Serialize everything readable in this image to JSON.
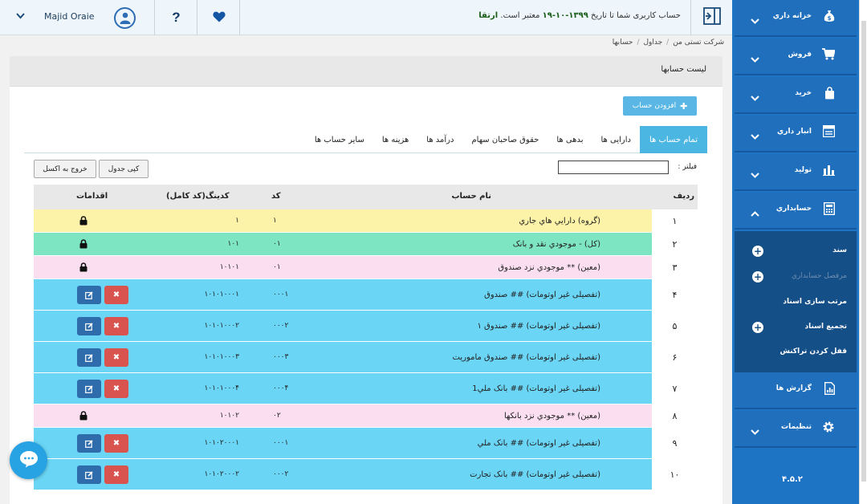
{
  "header": {
    "user_name": "Majid Oraie",
    "help_label": "?",
    "account_msg_prefix": "حساب کاربری شما تا تاریخ",
    "account_msg_date": "۱۳۹۹-۱۰-۱۹",
    "account_msg_suffix": "معتبر است.",
    "upgrade_label": "ارتقا"
  },
  "breadcrumb": [
    "شرکت تستی من",
    "جداول",
    "حسابها"
  ],
  "panel": {
    "title": "لیست حسابها",
    "add_button": "افزودن حساب",
    "filter_label": "فیلتر :",
    "filter_value": "",
    "copy_button": "کپی جدول",
    "excel_button": "خروج به اکسل"
  },
  "tabs": [
    "تمام حساب ها",
    "دارایی ها",
    "بدهی ها",
    "حقوق صاحبان سهام",
    "درآمد ها",
    "هزینه ها",
    "سایر حساب ها"
  ],
  "table": {
    "headers": {
      "row": "ردیف",
      "name": "نام حساب",
      "code": "کد",
      "full_code": "کدینگ(کد کامل)",
      "actions": "اقدامات"
    },
    "rows": [
      {
        "n": "۱",
        "name": "(گروه) دارايي هاي جاري",
        "code": "۱",
        "full": "۱",
        "type": "group",
        "color": "#fdf3a8"
      },
      {
        "n": "۲",
        "name": "(کل) - موجودي نقد و بانک",
        "code": "۰۱",
        "full": "۱۰۱",
        "type": "general",
        "color": "#7ee5c3"
      },
      {
        "n": "۳",
        "name": "(معین) ** موجودي نزد صندوق",
        "code": "۰۱",
        "full": "۱۰۱۰۱",
        "type": "subsidiary",
        "color": "#fbdff1"
      },
      {
        "n": "۴",
        "name": "(تفصیلی غیر اوتومات) ## صندوق",
        "code": "۰۰۰۱",
        "full": "۱۰۱۰۱۰۰۰۱",
        "type": "detail",
        "color": "#6ad5f5"
      },
      {
        "n": "۵",
        "name": "(تفصیلی غیر اوتومات) ## صندوق ۱",
        "code": "۰۰۰۲",
        "full": "۱۰۱۰۱۰۰۰۲",
        "type": "detail",
        "color": "#6ad5f5"
      },
      {
        "n": "۶",
        "name": "(تفصیلی غیر اوتومات) ## صندوق ماموريت",
        "code": "۰۰۰۳",
        "full": "۱۰۱۰۱۰۰۰۳",
        "type": "detail",
        "color": "#6ad5f5"
      },
      {
        "n": "۷",
        "name": "(تفصیلی غیر اوتومات) ## بانک ملي1",
        "code": "۰۰۰۴",
        "full": "۱۰۱۰۱۰۰۰۴",
        "type": "detail",
        "color": "#6ad5f5"
      },
      {
        "n": "۸",
        "name": "(معین) ** موجودي نزد بانکها",
        "code": "۰۲",
        "full": "۱۰۱۰۲",
        "type": "subsidiary",
        "color": "#fbdff1"
      },
      {
        "n": "۹",
        "name": "(تفصیلی غیر اوتومات) ## بانک ملي",
        "code": "۰۰۰۱",
        "full": "۱۰۱۰۲۰۰۰۱",
        "type": "detail",
        "color": "#6ad5f5"
      },
      {
        "n": "۱۰",
        "name": "(تفصیلی غیر اوتومات) ## بانک تجارت",
        "code": "۰۰۰۲",
        "full": "۱۰۱۰۲۰۰۰۲",
        "type": "detail",
        "color": "#6ad5f5"
      }
    ]
  },
  "sidebar": {
    "items": [
      {
        "label": "خزانه داري",
        "icon": "money-bag-icon"
      },
      {
        "label": "فروش",
        "icon": "cart-icon"
      },
      {
        "label": "خريد",
        "icon": "shopping-bag-icon"
      },
      {
        "label": "انبار داري",
        "icon": "warehouse-icon"
      },
      {
        "label": "توليد",
        "icon": "factory-icon"
      },
      {
        "label": "حسابداري",
        "icon": "calculator-icon"
      },
      {
        "label": "گزارش ها",
        "icon": "report-icon"
      },
      {
        "label": "تنظيمات",
        "icon": "gear-icon"
      }
    ],
    "submenu": [
      {
        "label": "سند",
        "plus": true,
        "dim": false
      },
      {
        "label": "مرفصل حسابداري",
        "plus": true,
        "dim": true
      },
      {
        "label": "مرتب سازی اسناد",
        "plus": false,
        "dim": false
      },
      {
        "label": "تجمیع اسناد",
        "plus": true,
        "dim": false
      },
      {
        "label": "قفل کردن تراکنش",
        "plus": false,
        "dim": false
      }
    ],
    "version": "۴.۵.۲"
  }
}
